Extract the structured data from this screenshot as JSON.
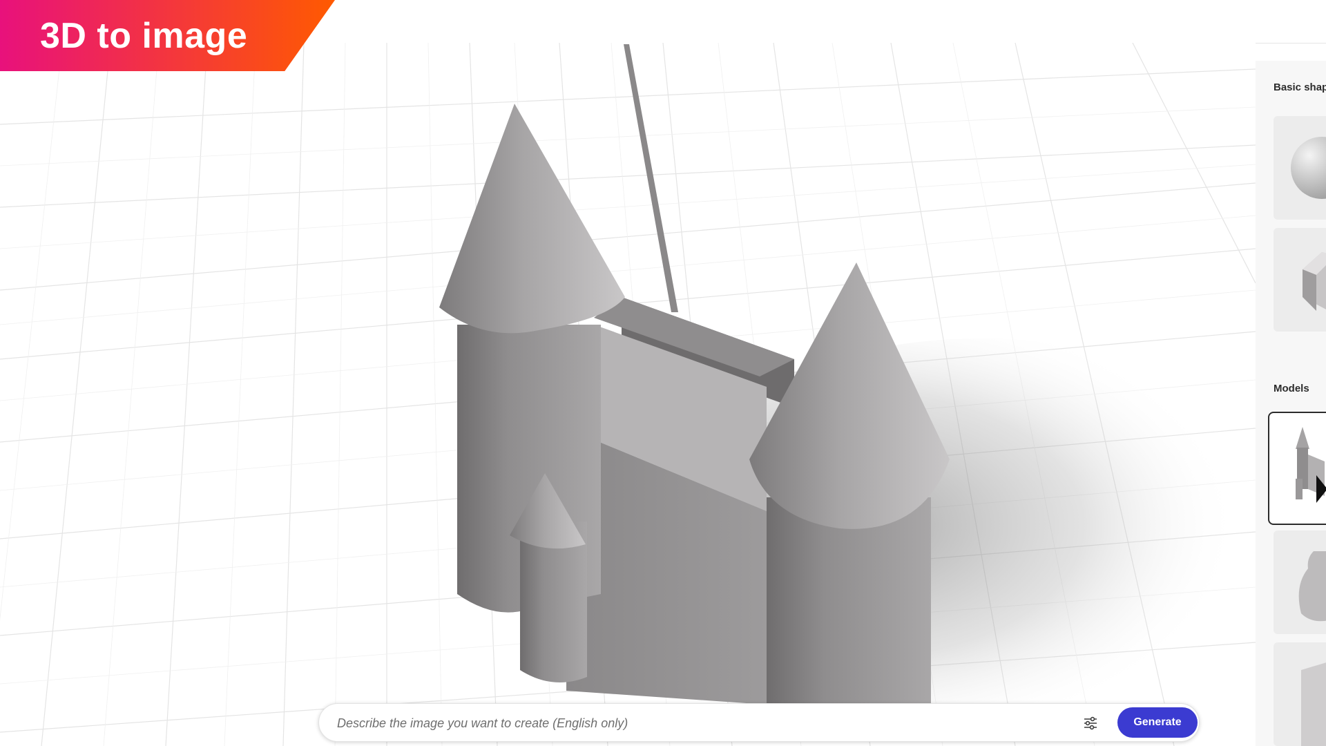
{
  "banner": {
    "title": "3D to image",
    "gradient_start": "#e8117c",
    "gradient_end": "#ff5a00"
  },
  "right_panel": {
    "basic_shapes_title": "Basic shap",
    "models_title": "Models",
    "basic_shapes": [
      {
        "icon": "sphere-icon"
      },
      {
        "icon": "cube-icon"
      }
    ],
    "models": [
      {
        "icon": "castle-model-icon",
        "selected": true
      },
      {
        "icon": "vase-model-icon",
        "selected": false
      },
      {
        "icon": "model-icon",
        "selected": false
      }
    ]
  },
  "prompt": {
    "placeholder": "Describe the image you want to create (English only)",
    "settings_icon": "settings-sliders-icon",
    "generate_label": "Generate",
    "accent_color": "#3b3bd1"
  }
}
